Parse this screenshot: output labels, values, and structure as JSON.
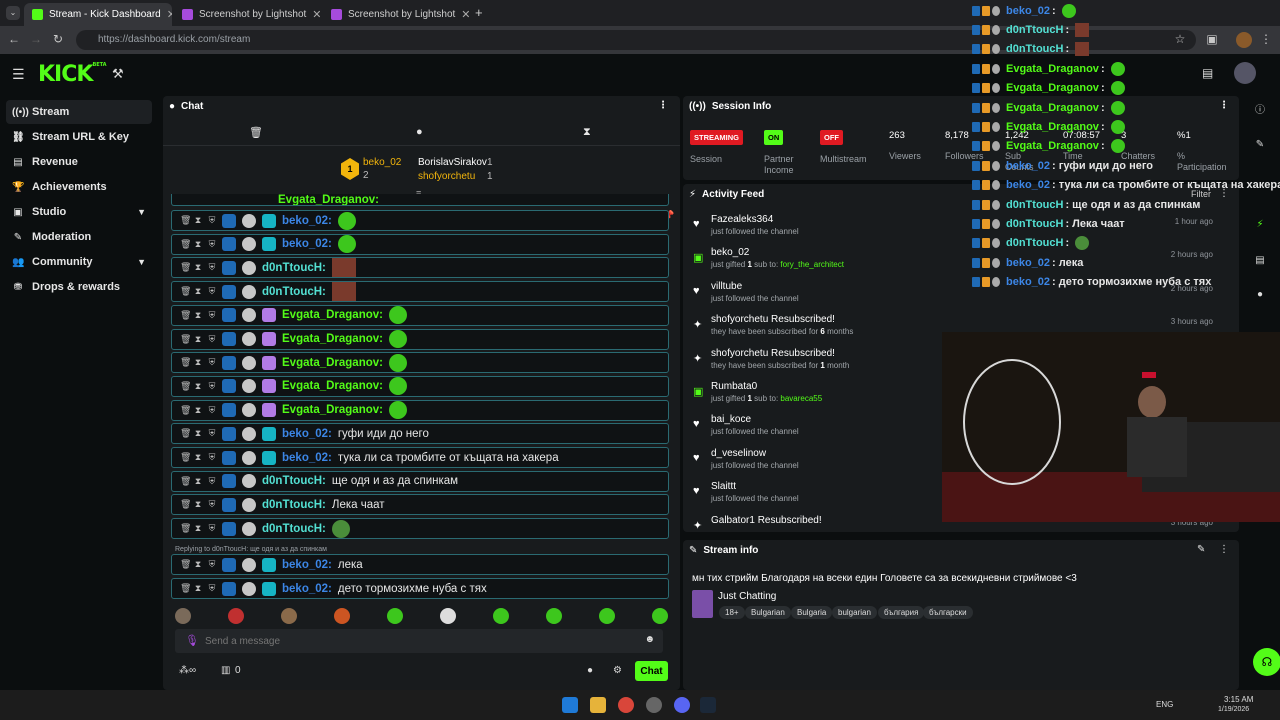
{
  "browser": {
    "tabs": [
      {
        "title": "Stream - Kick Dashboard"
      },
      {
        "title": "Screenshot by Lightshot"
      },
      {
        "title": "Screenshot by Lightshot"
      }
    ],
    "url": "https://dashboard.kick.com/stream"
  },
  "header": {
    "logo": "KICK",
    "logo_badge": "BETA"
  },
  "sidebar": {
    "items": [
      {
        "label": "Stream",
        "icon": "broadcast-icon",
        "active": true
      },
      {
        "label": "Stream URL & Key",
        "icon": "link-icon"
      },
      {
        "label": "Revenue",
        "icon": "chart-icon"
      },
      {
        "label": "Achievements",
        "icon": "trophy-icon"
      },
      {
        "label": "Studio",
        "icon": "monitor-icon",
        "expandable": true
      },
      {
        "label": "Moderation",
        "icon": "wrench-icon"
      },
      {
        "label": "Community",
        "icon": "people-icon",
        "expandable": true
      },
      {
        "label": "Drops & rewards",
        "icon": "gift-icon"
      }
    ]
  },
  "chat": {
    "title": "Chat",
    "leaderboard": {
      "first_name": "beko_02",
      "first_count": "2",
      "second_name": "BorislavSirakov",
      "second_count": "1",
      "third_name": "shofyorchetu",
      "third_count": "1"
    },
    "top_row_name": "Evgata_Draganov:",
    "messages": [
      {
        "user": "beko_02:",
        "color": "#3c86e6",
        "text": "",
        "emote": "green"
      },
      {
        "user": "beko_02:",
        "color": "#3c86e6",
        "text": "",
        "emote": "green"
      },
      {
        "user": "d0nTtoucH:",
        "color": "#53e0d3",
        "text": "",
        "emote": "pic"
      },
      {
        "user": "d0nTtoucH:",
        "color": "#53e0d3",
        "text": "",
        "emote": "pic"
      },
      {
        "user": "Evgata_Draganov:",
        "color": "#53fc18",
        "text": "",
        "emote": "green"
      },
      {
        "user": "Evgata_Draganov:",
        "color": "#53fc18",
        "text": "",
        "emote": "green"
      },
      {
        "user": "Evgata_Draganov:",
        "color": "#53fc18",
        "text": "",
        "emote": "green"
      },
      {
        "user": "Evgata_Draganov:",
        "color": "#53fc18",
        "text": "",
        "emote": "green"
      },
      {
        "user": "Evgata_Draganov:",
        "color": "#53fc18",
        "text": "",
        "emote": "green"
      },
      {
        "user": "beko_02:",
        "color": "#3c86e6",
        "text": " гуфи иди до него",
        "emote": ""
      },
      {
        "user": "beko_02:",
        "color": "#3c86e6",
        "text": " тука ли са тромбите от къщата на хакера",
        "emote": ""
      },
      {
        "user": "d0nTtoucH:",
        "color": "#53e0d3",
        "text": " ще одя и аз да спинкам",
        "emote": ""
      },
      {
        "user": "d0nTtoucH:",
        "color": "#53e0d3",
        "text": " Лека чаат",
        "emote": ""
      },
      {
        "user": "d0nTtoucH:",
        "color": "#53e0d3",
        "text": "",
        "emote": "pepe"
      }
    ],
    "reply_note": "Replying to d0nTtoucH: ще одя и аз да спинкам",
    "reply_messages": [
      {
        "user": "beko_02:",
        "color": "#3c86e6",
        "text": " лека"
      },
      {
        "user": "beko_02:",
        "color": "#3c86e6",
        "text": " дето тормозихме нуба с тях"
      }
    ],
    "input_placeholder": "Send a message",
    "footer_count": "0",
    "chat_button": "Chat"
  },
  "session": {
    "title": "Session Info",
    "streaming": "STREAMING",
    "streaming_label": "Session",
    "partner": "ON",
    "partner_label": "Partner Income",
    "multistream": "OFF",
    "multistream_label": "Multistream",
    "viewers": "263",
    "viewers_label": "Viewers",
    "followers": "8,178",
    "followers_label": "Followers",
    "subs": "1,242",
    "subs_label": "Sub Counts",
    "time": "07:08:57",
    "time_label": "Time",
    "chatters": "3",
    "chatters_label": "Chatters",
    "participation": "%1",
    "participation_label": "% Participation"
  },
  "activity": {
    "title": "Activity Feed",
    "filter": "Filter",
    "items": [
      {
        "icon": "heart",
        "name": "Fazealeks364",
        "sub": "just followed the channel",
        "time": "1 hour ago"
      },
      {
        "icon": "gift",
        "name": "beko_02",
        "sub": "just gifted ",
        "count": "1",
        "sub2": " sub to: ",
        "target": "fory_the_architect",
        "time": "2 hours ago"
      },
      {
        "icon": "heart",
        "name": "villtube",
        "sub": "just followed the channel",
        "time": "2 hours ago"
      },
      {
        "icon": "star",
        "name": "shofyorchetu Resubscribed!",
        "sub": "they have been subscribed for ",
        "count": "6",
        "sub2": " months",
        "time": "3 hours ago"
      },
      {
        "icon": "star",
        "name": "shofyorchetu Resubscribed!",
        "sub": "they have been subscribed for ",
        "count": "1",
        "sub2": " month",
        "time": ""
      },
      {
        "icon": "gift",
        "name": "Rumbata0",
        "sub": "just gifted ",
        "count": "1",
        "sub2": " sub to: ",
        "target": "bavareca55",
        "time": ""
      },
      {
        "icon": "heart",
        "name": "bai_koce",
        "sub": "just followed the channel",
        "time": ""
      },
      {
        "icon": "heart",
        "name": "d_veselinow",
        "sub": "just followed the channel",
        "time": ""
      },
      {
        "icon": "heart",
        "name": "Slaittt",
        "sub": "just followed the channel",
        "time": ""
      },
      {
        "icon": "star",
        "name": "Galbator1 Resubscribed!",
        "sub": "",
        "time": "3 hours ago"
      }
    ]
  },
  "stream_info": {
    "title": "Stream info",
    "stream_title": "мн тих стрийм   Благодаря на всеки един Головете са за всекидневни стриймове <3",
    "category": "Just Chatting",
    "tags": [
      "18+",
      "Bulgarian",
      "Bulgaria",
      "bulgarian",
      "българия",
      "български"
    ]
  },
  "overlay": {
    "lines": [
      {
        "user": "beko_02",
        "color": "#3c86e6",
        "text": " :",
        "emote": "green"
      },
      {
        "user": "d0nTtoucH",
        "color": "#53e0d3",
        "text": " :",
        "emote": "pic"
      },
      {
        "user": "d0nTtoucH",
        "color": "#53e0d3",
        "text": " :",
        "emote": "pic"
      },
      {
        "user": "Evgata_Draganov",
        "color": "#53fc18",
        "text": " :",
        "emote": "green"
      },
      {
        "user": "Evgata_Draganov",
        "color": "#53fc18",
        "text": " :",
        "emote": "green"
      },
      {
        "user": "Evgata_Draganov",
        "color": "#53fc18",
        "text": " :",
        "emote": "green"
      },
      {
        "user": "Evgata_Draganov",
        "color": "#53fc18",
        "text": " :",
        "emote": "green"
      },
      {
        "user": "Evgata_Draganov",
        "color": "#53fc18",
        "text": " :",
        "emote": "green"
      },
      {
        "user": "beko_02",
        "color": "#3c86e6",
        "text": " : гуфи иди до него",
        "emote": ""
      },
      {
        "user": "beko_02",
        "color": "#3c86e6",
        "text": " : тука ли са тромбите от къщата на хакера",
        "emote": ""
      },
      {
        "user": "d0nTtoucH",
        "color": "#53e0d3",
        "text": " : ще одя и аз да спинкам",
        "emote": ""
      },
      {
        "user": "d0nTtoucH",
        "color": "#53e0d3",
        "text": " : Лека чаат",
        "emote": ""
      },
      {
        "user": "d0nTtoucH",
        "color": "#53e0d3",
        "text": " :",
        "emote": "pepe"
      },
      {
        "user": "beko_02",
        "color": "#3c86e6",
        "text": " : лека",
        "emote": ""
      },
      {
        "user": "beko_02",
        "color": "#3c86e6",
        "text": " : дето тормозихме нуба с тях",
        "emote": ""
      }
    ]
  },
  "taskbar": {
    "lang": "ENG",
    "time": "3:15 AM",
    "date": "1/19/2026"
  }
}
